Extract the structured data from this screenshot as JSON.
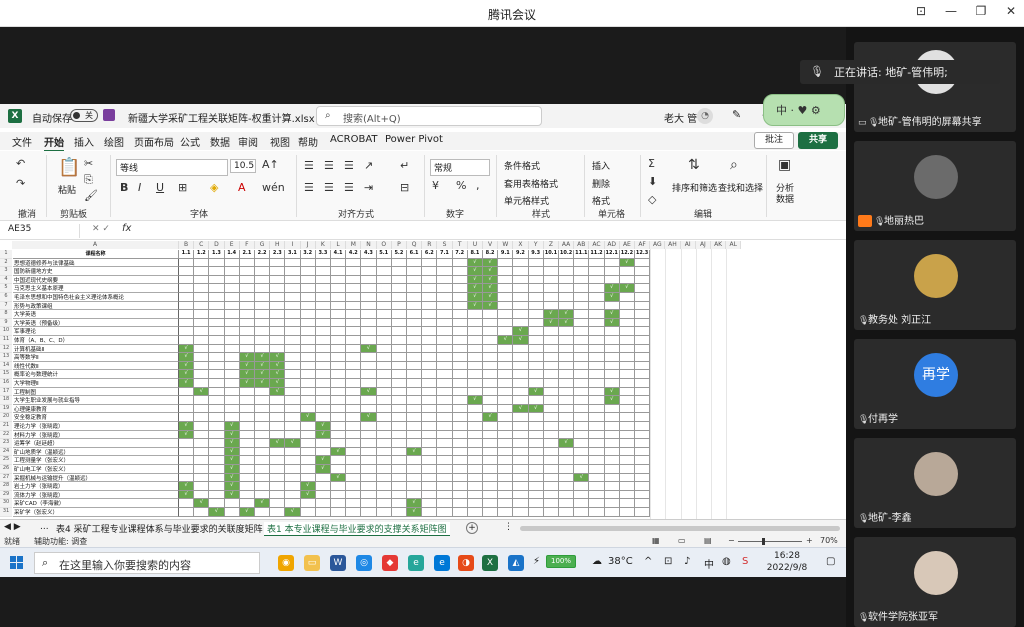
{
  "window": {
    "title": "腾讯会议"
  },
  "speaking": {
    "text": "正在讲话: 地矿-管伟明;"
  },
  "excel": {
    "autosave_label": "自动保存",
    "autosave_state": "关",
    "filename": "新疆大学采矿工程关联矩阵-权重计算.xlsx",
    "search_placeholder": "搜索(Alt+Q)",
    "user": "老大 管",
    "tabs": [
      "文件",
      "开始",
      "插入",
      "绘图",
      "页面布局",
      "公式",
      "数据",
      "审阅",
      "视图",
      "帮助",
      "ACROBAT",
      "Power Pivot"
    ],
    "active_tab": "开始",
    "comment_label": "批注",
    "share_label": "共享",
    "ribbon": {
      "undo_label": "撤消",
      "clipboard_label": "剪贴板",
      "paste_label": "粘贴",
      "font_label": "字体",
      "font_name": "等线",
      "font_size": "10.5",
      "align_label": "对齐方式",
      "number_label": "数字",
      "number_format": "常规",
      "styles_label": "样式",
      "cond_format": "条件格式",
      "table_format": "套用表格格式",
      "cell_style": "单元格样式",
      "cells_label": "单元格",
      "insert": "插入",
      "delete": "删除",
      "format": "格式",
      "editing_label": "编辑",
      "sort_filter": "排序和筛选",
      "find_select": "查找和选择",
      "analyze": "分析",
      "analyze2": "数据"
    },
    "badge_text": "中",
    "namebox": "AE35",
    "fx_symbol": "fx",
    "columns": [
      "A",
      "B",
      "C",
      "D",
      "E",
      "F",
      "G",
      "H",
      "I",
      "J",
      "K",
      "L",
      "M",
      "N",
      "O",
      "P",
      "Q",
      "R",
      "S",
      "T",
      "U",
      "V",
      "W",
      "X",
      "Y",
      "Z",
      "AA",
      "AB",
      "AC",
      "AD",
      "AE",
      "AF",
      "AG",
      "AH",
      "AI",
      "AJ",
      "AK",
      "AL"
    ],
    "header_name": "课程名称",
    "indicators": [
      "1.1",
      "1.2",
      "1.3",
      "1.4",
      "2.1",
      "2.2",
      "2.3",
      "3.1",
      "3.2",
      "3.3",
      "4.1",
      "4.2",
      "4.3",
      "5.1",
      "5.2",
      "6.1",
      "6.2",
      "7.1",
      "7.2",
      "8.1",
      "8.2",
      "9.1",
      "9.2",
      "9.3",
      "10.1",
      "10.2",
      "11.1",
      "11.2",
      "12.1",
      "12.2",
      "12.3"
    ],
    "check_mark": "√",
    "rows": [
      {
        "n": "2",
        "name": "思想道德修养与法律基础",
        "on": [
          19,
          20,
          29
        ]
      },
      {
        "n": "3",
        "name": "国防新疆地方史",
        "on": [
          19,
          20
        ]
      },
      {
        "n": "4",
        "name": "中国近现代史纲要",
        "on": [
          19,
          20
        ]
      },
      {
        "n": "5",
        "name": "马克思主义基本原理",
        "on": [
          19,
          20,
          28,
          29
        ]
      },
      {
        "n": "6",
        "name": "毛泽东思想和中国特色社会主义理论体系概论",
        "on": [
          19,
          20,
          28
        ]
      },
      {
        "n": "7",
        "name": "形势与政策课组",
        "on": [
          19,
          20
        ]
      },
      {
        "n": "8",
        "name": "大学英语",
        "on": [
          24,
          25,
          28
        ]
      },
      {
        "n": "9",
        "name": "大学英语（预备级）",
        "on": [
          24,
          25,
          28
        ]
      },
      {
        "n": "10",
        "name": "军事理论",
        "on": [
          22
        ]
      },
      {
        "n": "11",
        "name": "体育（A、B、C、D）",
        "on": [
          21,
          22
        ]
      },
      {
        "n": "12",
        "name": "计算机基础Ⅱ",
        "on": [
          0,
          12
        ]
      },
      {
        "n": "13",
        "name": "高等数学Ⅱ",
        "on": [
          0,
          4,
          5,
          6
        ]
      },
      {
        "n": "14",
        "name": "线性代数Ⅱ",
        "on": [
          0,
          4,
          5,
          6
        ]
      },
      {
        "n": "15",
        "name": "概率论与数理统计",
        "on": [
          0,
          4,
          5,
          6
        ]
      },
      {
        "n": "16",
        "name": "大学物理Ⅱ",
        "on": [
          0,
          4,
          5,
          6
        ]
      },
      {
        "n": "17",
        "name": "工程制图",
        "on": [
          1,
          6,
          12,
          23,
          28
        ]
      },
      {
        "n": "18",
        "name": "大学生职业发展与就业指导",
        "on": [
          19,
          28
        ]
      },
      {
        "n": "19",
        "name": "心理健康教育",
        "on": [
          22,
          23
        ]
      },
      {
        "n": "20",
        "name": "安全稳定教育",
        "on": [
          8,
          12,
          20
        ]
      },
      {
        "n": "21",
        "name": "理论力学（张晓霞）",
        "on": [
          0,
          3,
          9
        ]
      },
      {
        "n": "22",
        "name": "材料力学（张晓霞）",
        "on": [
          0,
          3,
          9
        ]
      },
      {
        "n": "23",
        "name": "运筹学（赵廷超）",
        "on": [
          3,
          6,
          7,
          25
        ]
      },
      {
        "n": "24",
        "name": "矿山地质学（温颖远）",
        "on": [
          3,
          10,
          15
        ]
      },
      {
        "n": "25",
        "name": "工程测量学（张宏义）",
        "on": [
          3,
          9
        ]
      },
      {
        "n": "26",
        "name": "矿山电工学（张宏义）",
        "on": [
          3,
          9
        ]
      },
      {
        "n": "27",
        "name": "采掘机械与运输提升（温颖远）",
        "on": [
          3,
          10,
          26
        ]
      },
      {
        "n": "28",
        "name": "岩土力学（张晓霞）",
        "on": [
          0,
          3,
          8
        ]
      },
      {
        "n": "29",
        "name": "流体力学（张晓霞）",
        "on": [
          0,
          3,
          8
        ]
      },
      {
        "n": "30",
        "name": "采矿CAD（李海徽）",
        "on": [
          1,
          5,
          15
        ]
      },
      {
        "n": "31",
        "name": "采矿学（张宏义）",
        "on": [
          2,
          4,
          7,
          15
        ]
      }
    ],
    "sheets": {
      "more": "...",
      "sheet1": "表4 采矿工程专业课程体系与毕业要求的关联度矩阵",
      "sheet2": "表1 本专业课程与毕业要求的支撑关系矩阵图",
      "add": "+"
    },
    "status": {
      "ready": "就绪",
      "accessibility": "辅助功能: 调查",
      "zoom": "70%",
      "minus": "−",
      "plus": "+"
    }
  },
  "taskbar": {
    "search_placeholder": "在这里输入你要搜索的内容",
    "battery": "100%",
    "temp": "38°C",
    "ime": "中",
    "time": "16:28",
    "date": "2022/9/8"
  },
  "participants": [
    {
      "name": "地矿-管伟明的屏幕共享",
      "type": "screen"
    },
    {
      "name": "地丽热巴",
      "type": "photo"
    },
    {
      "name": "教务处 刘正江",
      "type": "photo"
    },
    {
      "name": "付再学",
      "type": "text",
      "initials": "再学"
    },
    {
      "name": "地矿-李鑫",
      "type": "photo"
    },
    {
      "name": "软件学院张亚军",
      "type": "photo"
    }
  ]
}
